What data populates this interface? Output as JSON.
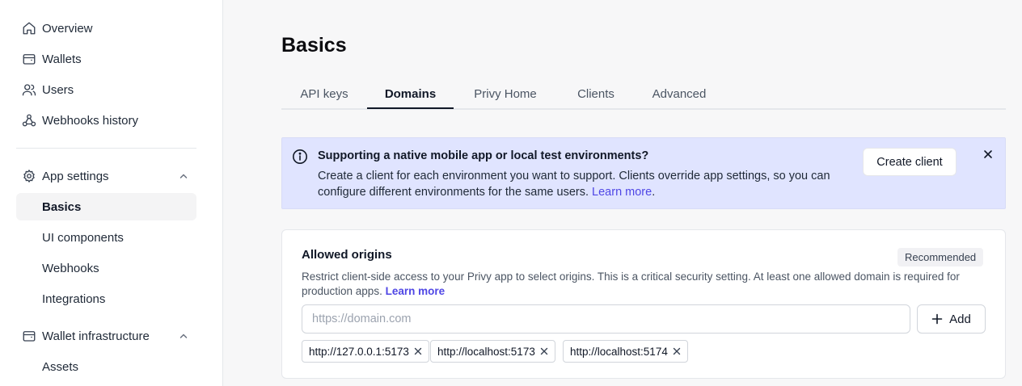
{
  "sidebar": {
    "top_items": [
      {
        "label": "Overview",
        "icon": "home-icon"
      },
      {
        "label": "Wallets",
        "icon": "wallet-icon"
      },
      {
        "label": "Users",
        "icon": "users-icon"
      },
      {
        "label": "Webhooks history",
        "icon": "webhook-icon"
      }
    ],
    "app_settings": {
      "label": "App settings",
      "icon": "gear-icon",
      "items": [
        "Basics",
        "UI components",
        "Webhooks",
        "Integrations"
      ],
      "active": "Basics"
    },
    "wallet_infra": {
      "label": "Wallet infrastructure",
      "icon": "wallet-icon",
      "items": [
        "Assets"
      ]
    }
  },
  "main": {
    "title": "Basics",
    "tabs": [
      "API keys",
      "Domains",
      "Privy Home",
      "Clients",
      "Advanced"
    ],
    "active_tab": "Domains"
  },
  "banner": {
    "title": "Supporting a native mobile app or local test environments?",
    "text": "Create a client for each environment you want to support. Clients override app settings, so you can configure different environments for the same users.",
    "link": "Learn more",
    "period": ".",
    "button": "Create client"
  },
  "origins": {
    "title": "Allowed origins",
    "badge": "Recommended",
    "description": "Restrict client-side access to your Privy app to select origins. This is a critical security setting. At least one allowed domain is required for production apps.",
    "link": "Learn more",
    "input_placeholder": "https://domain.com",
    "input_value": "",
    "add_button": "Add",
    "chips": [
      "http://127.0.0.1:5173",
      "http://localhost:5173",
      "http://localhost:5174"
    ]
  },
  "colors": {
    "accent": "#4f46e5",
    "banner_bg": "#e0e4ff"
  }
}
